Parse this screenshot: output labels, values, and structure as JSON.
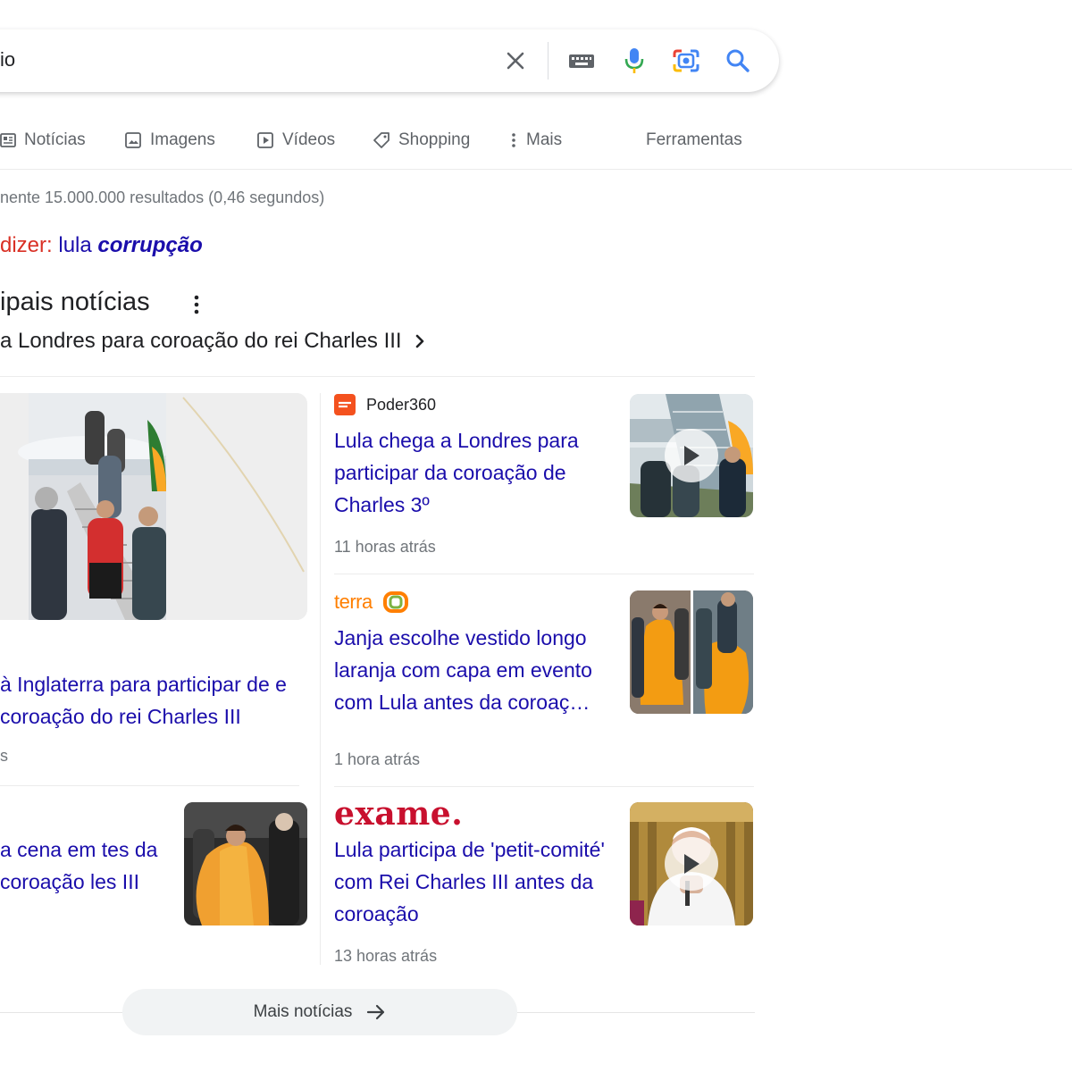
{
  "search": {
    "query_visible": "io",
    "icons": [
      "close-icon",
      "keyboard-icon",
      "mic-icon",
      "camera-lens-icon",
      "search-icon"
    ]
  },
  "tabs": [
    {
      "label": "Notícias",
      "icon": "news-icon"
    },
    {
      "label": "Imagens",
      "icon": "image-icon"
    },
    {
      "label": "Vídeos",
      "icon": "video-icon"
    },
    {
      "label": "Shopping",
      "icon": "tag-icon"
    },
    {
      "label": "Mais",
      "icon": "more-vert-icon"
    },
    {
      "label": "Ferramentas"
    }
  ],
  "results_stats": "nente 15.000.000 resultados (0,46 segundos)",
  "did_you_mean": {
    "prefix": "dizer:",
    "plain": "lula",
    "emphasis": "corrupção"
  },
  "top_stories": {
    "heading": "ipais notícias",
    "story_link": "a Londres para coroação do rei Charles III"
  },
  "left_cards": [
    {
      "title": "à Inglaterra para participar de e coroação do rei Charles III",
      "time": "s"
    },
    {
      "title": "a cena em tes da coroação les III"
    }
  ],
  "articles": [
    {
      "source": "Poder360",
      "title": "Lula chega a Londres para participar da coroação de Charles 3º",
      "time": "11 horas atrás",
      "has_video": true
    },
    {
      "source": "terra",
      "title": "Janja escolhe vestido longo laranja com capa em evento com Lula antes da coroaç…",
      "time": "1 hora atrás",
      "has_video": false
    },
    {
      "source": "exame.",
      "title": "Lula participa de 'petit-comité' com Rei Charles III antes da coroação",
      "time": "13 horas atrás",
      "has_video": true
    }
  ],
  "more_news": {
    "label": "Mais notícias"
  },
  "colors": {
    "link": "#1a0dab",
    "correction_red": "#d93025",
    "meta_gray": "#70757a",
    "poder360_orange": "#f4511e",
    "terra_orange": "#ff7f00",
    "exame_red": "#c8102e"
  }
}
